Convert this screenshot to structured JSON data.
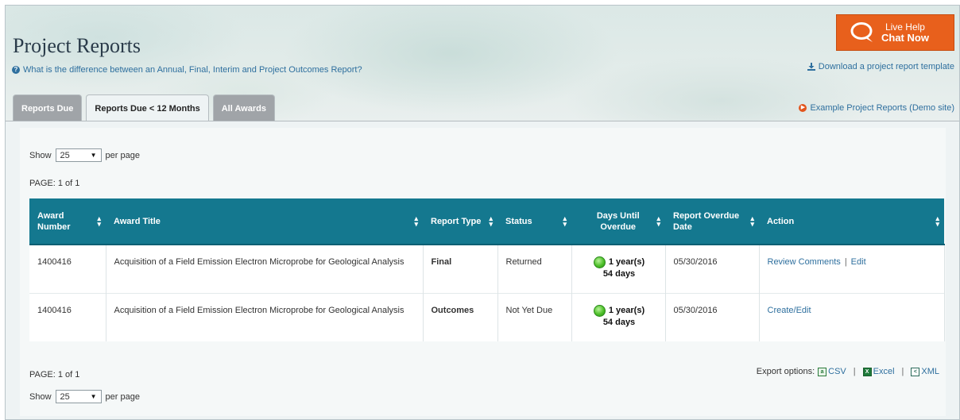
{
  "header": {
    "title": "Project Reports",
    "help_link": "What is the difference between an Annual, Final, Interim and Project Outcomes Report?",
    "live_help": {
      "line1": "Live Help",
      "line2": "Chat Now"
    },
    "download_link": "Download a project report template",
    "example_link": "Example Project Reports (Demo site)"
  },
  "tabs": [
    {
      "label": "Reports Due",
      "active": false
    },
    {
      "label": "Reports Due < 12 Months",
      "active": true
    },
    {
      "label": "All Awards",
      "active": false
    }
  ],
  "paging": {
    "show_label": "Show",
    "per_page_value": "25",
    "per_page_label": "per page",
    "page_text": "PAGE: 1 of 1"
  },
  "table": {
    "columns": [
      {
        "label": "Award Number"
      },
      {
        "label": "Award Title"
      },
      {
        "label": "Report Type"
      },
      {
        "label": "Status"
      },
      {
        "label": "Days Until Overdue"
      },
      {
        "label": "Report Overdue Date"
      },
      {
        "label": "Action"
      }
    ],
    "rows": [
      {
        "award_number": "1400416",
        "award_title": "Acquisition of a Field Emission Electron Microprobe for Geological Analysis",
        "report_type": "Final",
        "status": "Returned",
        "days_line1": "1 year(s)",
        "days_line2": "54 days",
        "overdue_date": "05/30/2016",
        "actions": [
          "Review Comments",
          "Edit"
        ]
      },
      {
        "award_number": "1400416",
        "award_title": "Acquisition of a Field Emission Electron Microprobe for Geological Analysis",
        "report_type": "Outcomes",
        "status": "Not Yet Due",
        "days_line1": "1 year(s)",
        "days_line2": "54 days",
        "overdue_date": "05/30/2016",
        "actions": [
          "Create/Edit"
        ]
      }
    ]
  },
  "export": {
    "label": "Export options:",
    "csv": "CSV",
    "excel": "Excel",
    "xml": "XML"
  },
  "colors": {
    "header_teal": "#14788f",
    "link_blue": "#2e6f9e",
    "live_help_orange": "#e8601c",
    "tab_inactive": "#a0a4a8"
  }
}
